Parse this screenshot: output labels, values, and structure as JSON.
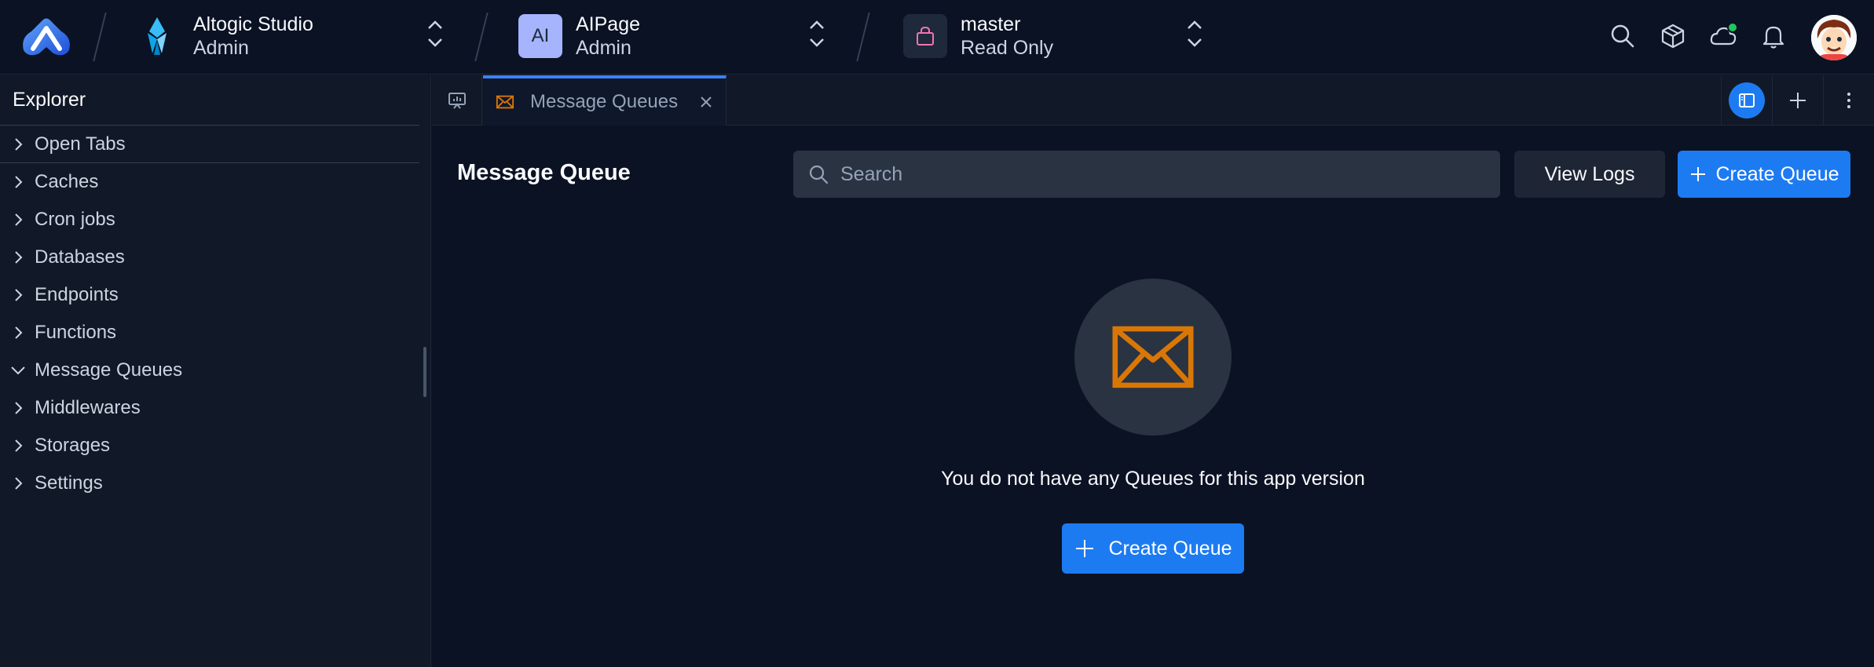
{
  "header": {
    "org": {
      "name": "Altogic Studio",
      "role": "Admin"
    },
    "app": {
      "badge": "AI",
      "name": "AIPage",
      "role": "Admin"
    },
    "env": {
      "name": "master",
      "mode": "Read Only"
    },
    "icons": [
      "search-icon",
      "cube-icon",
      "cloud-status-icon",
      "bell-icon",
      "user-avatar"
    ]
  },
  "sidebar": {
    "title": "Explorer",
    "items": [
      {
        "label": "Open Tabs",
        "expanded": false
      },
      {
        "label": "Caches",
        "expanded": false
      },
      {
        "label": "Cron jobs",
        "expanded": false
      },
      {
        "label": "Databases",
        "expanded": false
      },
      {
        "label": "Endpoints",
        "expanded": false
      },
      {
        "label": "Functions",
        "expanded": false
      },
      {
        "label": "Message Queues",
        "expanded": true
      },
      {
        "label": "Middlewares",
        "expanded": false
      },
      {
        "label": "Storages",
        "expanded": false
      },
      {
        "label": "Settings",
        "expanded": false
      }
    ]
  },
  "tabs": [
    {
      "label": "Message Queues",
      "active": true,
      "icon": "envelope-icon"
    }
  ],
  "main": {
    "title": "Message Queue",
    "search_placeholder": "Search",
    "view_logs_label": "View Logs",
    "create_label": "Create Queue",
    "empty_message": "You do not have any Queues for this app version",
    "empty_create_label": "Create Queue"
  },
  "colors": {
    "accent": "#1d7bf2",
    "envelope": "#d97706",
    "background": "#0b1224",
    "sidebar": "#111827",
    "online": "#22c55e"
  }
}
